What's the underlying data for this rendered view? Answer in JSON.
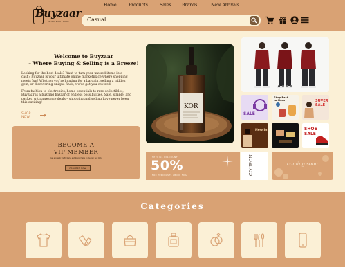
{
  "brand": {
    "name": "Buyzaar",
    "tagline": "SHOP WITH EASE"
  },
  "nav": {
    "items": [
      "Home",
      "Products",
      "Sales",
      "Brands",
      "New Arrivals"
    ]
  },
  "search": {
    "value": "Casual"
  },
  "header_icons": [
    "cart-icon",
    "gift-icon",
    "user-circle-icon",
    "hamburger-menu-icon"
  ],
  "hero": {
    "title": "Welcome to Buyzaar\n– Where Buying & Selling is a Breeze!",
    "paragraph1": "Looking for the best deals? Want to turn your unused items into cash? Buyzaar is your ultimate online marketplace where shopping meets fun! Whether you're hunting for a bargain, selling a hidden gem, or discovering unique finds, we've got you covered.",
    "paragraph2": "From fashion to electronics, home essentials to rare collectibles, Buyzaar is a buzzing bazaar of endless possibilities. Safe, simple, and packed with awesome deals – shopping and selling have never been this exciting!",
    "shop_now": "SHOP NOW"
  },
  "vip": {
    "title": "BECOME A\nVIP MEMBER",
    "description": "Get access to the Exclusive and Special Sales on Buyzaar App Only",
    "button": "REGISTER NOW"
  },
  "product_photo": {
    "label": "KOR"
  },
  "carousel": {
    "slides": 4,
    "active": 0
  },
  "mini_banners": [
    {
      "text": "SALE",
      "colors": [
        "#e7dbf3",
        "#7a3aa2"
      ]
    },
    {
      "text": "Shop Back to Class",
      "colors": [
        "#f6f2e8",
        "#2b1a0c"
      ]
    },
    {
      "text": "SUPER SALE",
      "colors": [
        "#f4e6d9",
        "#d12a2a"
      ]
    },
    {
      "text": "New In",
      "colors": [
        "#5a2e12",
        "#f2d2a6"
      ]
    },
    {
      "text": "",
      "colors": [
        "#111111",
        "#d9a274"
      ]
    },
    {
      "text": "SHOE SALE",
      "colors": [
        "#ffffff",
        "#c21f1f"
      ]
    }
  ],
  "discount": {
    "eyebrow": "SPECIAL DISCOUNT",
    "value": "50%",
    "footnote": "FOR PURCHASES ABOVE 50%"
  },
  "coupon": {
    "text": "COUPON"
  },
  "coming_soon": {
    "text": "coming soon"
  },
  "categories": {
    "title": "Categories",
    "items": [
      {
        "icon": "tshirt-icon"
      },
      {
        "icon": "makeup-icon"
      },
      {
        "icon": "handbag-icon"
      },
      {
        "icon": "perfume-bottle-icon"
      },
      {
        "icon": "ring-icon"
      },
      {
        "icon": "cutlery-icon"
      },
      {
        "icon": "smartphone-icon"
      }
    ]
  },
  "colors": {
    "brand_tan": "#d9a274",
    "cream": "#fbf0d6",
    "dark": "#1e1208",
    "accent": "#c77f4a"
  }
}
